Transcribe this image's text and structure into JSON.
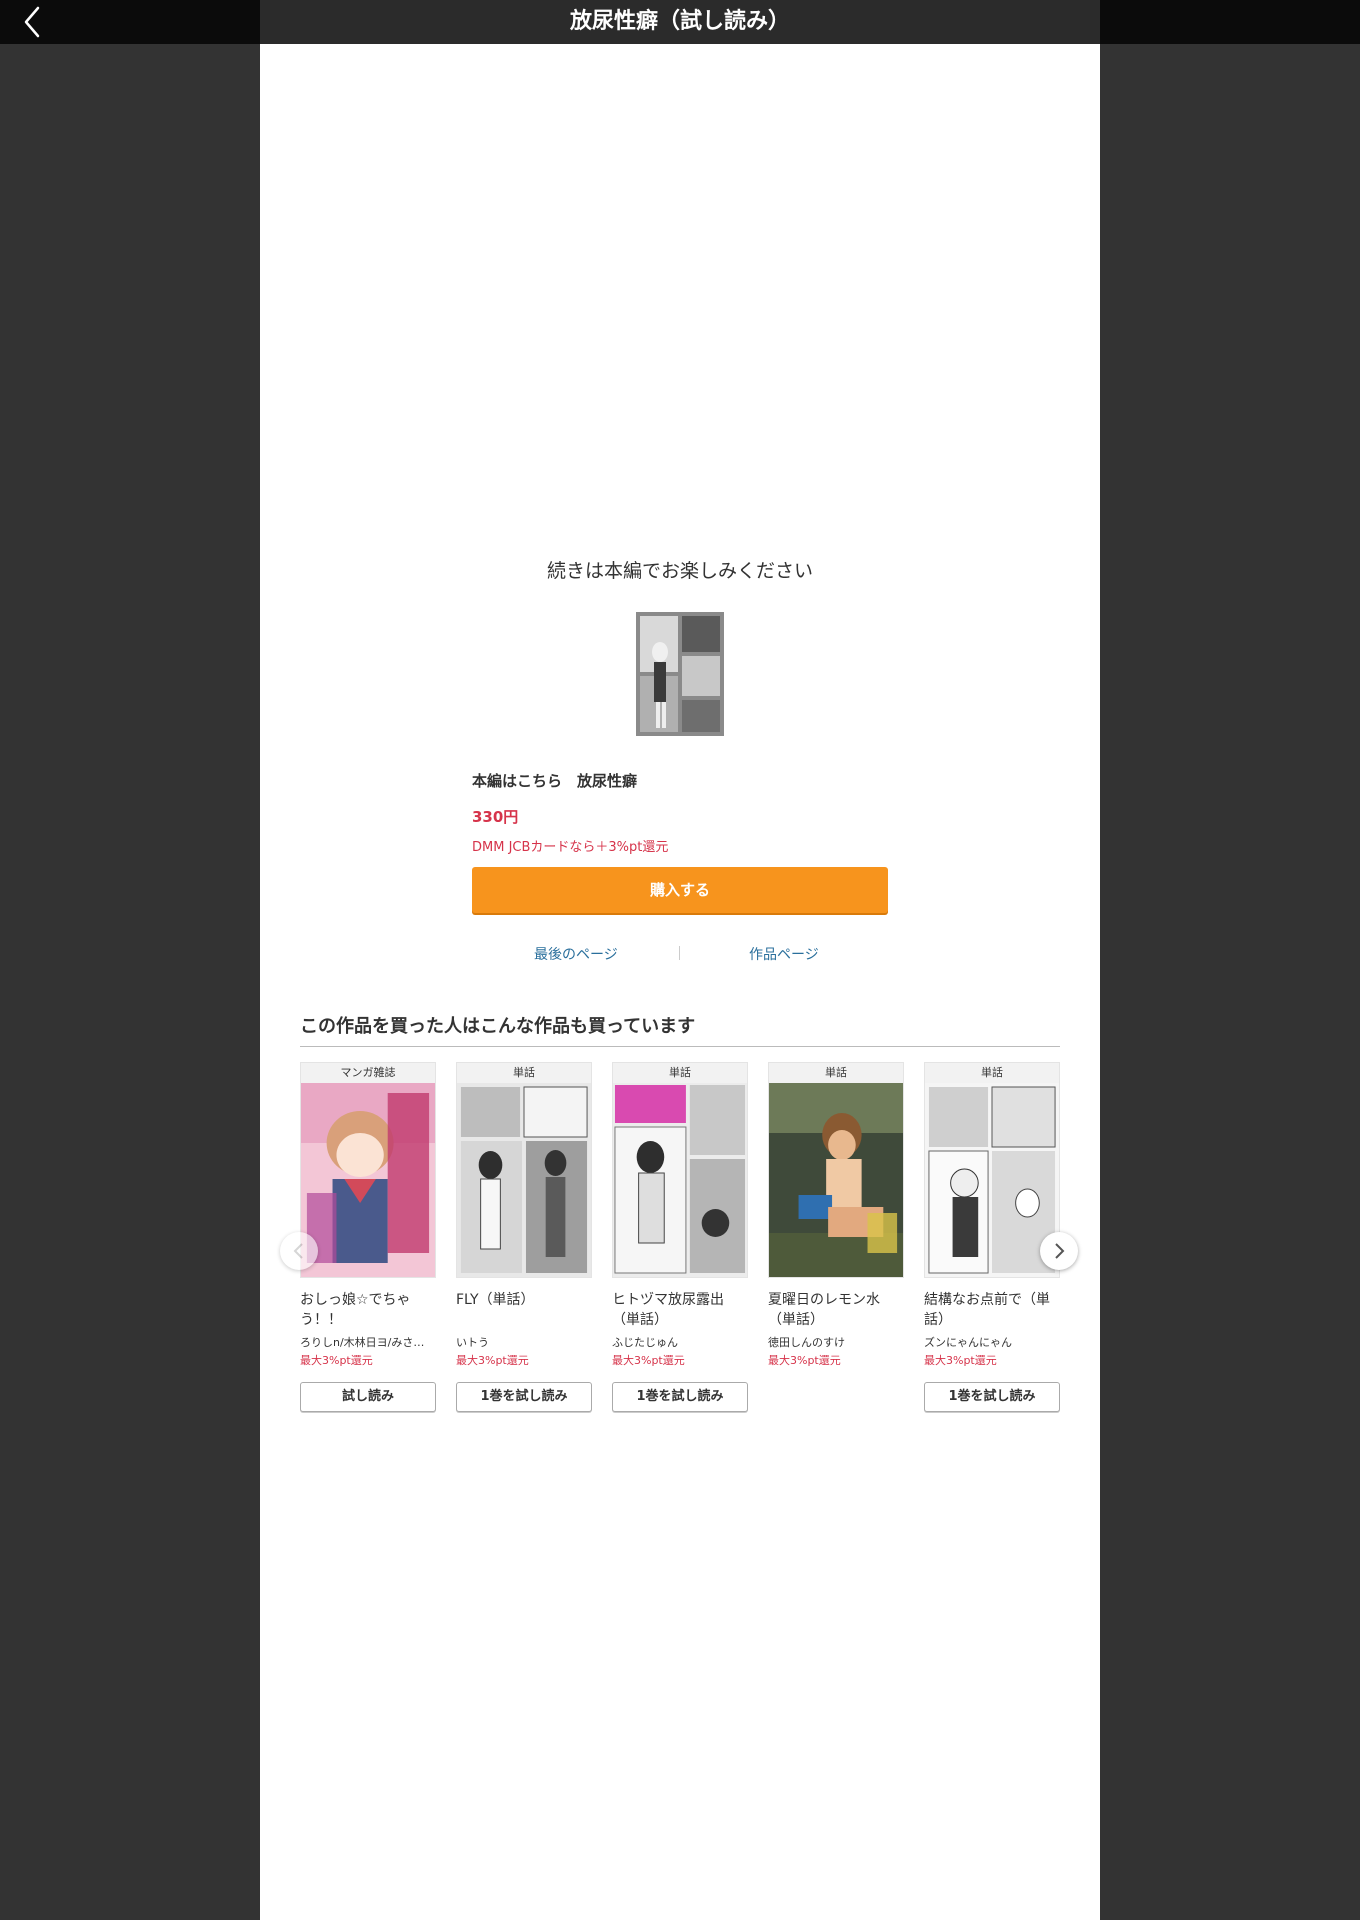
{
  "header": {
    "title": "放尿性癖（試し読み）",
    "back_icon": "chevron-left-icon"
  },
  "end_screen": {
    "message": "続きは本編でお楽しみください",
    "product_title": "本編はこちら　放尿性癖",
    "price": "330円",
    "point_note": "DMM JCBカードなら＋3%pt還元",
    "buy_label": "購入する",
    "last_page_label": "最後のページ",
    "work_page_label": "作品ページ"
  },
  "recommendations": {
    "heading": "この作品を買った人はこんな作品も買っています",
    "prev_icon": "chevron-left-icon",
    "next_icon": "chevron-right-icon",
    "items": [
      {
        "badge": "マンガ雑誌",
        "title": "おしっ娘☆でちゃう！！",
        "author": "ろりしn/木林日ヨ/みさ…",
        "points": "最大3%pt還元",
        "button": "試し読み"
      },
      {
        "badge": "単話",
        "title": "FLY（単話）",
        "author": "いトう",
        "points": "最大3%pt還元",
        "button": "1巻を試し読み"
      },
      {
        "badge": "単話",
        "title": "ヒトヅマ放尿露出（単話）",
        "author": "ふじたじゅん",
        "points": "最大3%pt還元",
        "button": "1巻を試し読み"
      },
      {
        "badge": "単話",
        "title": "夏曜日のレモン水（単話）",
        "author": "徳田しんのすけ",
        "points": "最大3%pt還元",
        "button": ""
      },
      {
        "badge": "単話",
        "title": "結構なお点前で（単話）",
        "author": "ズンにゃんにゃん",
        "points": "最大3%pt還元",
        "button": "1巻を試し読み"
      }
    ]
  },
  "colors": {
    "accent": "#f7941d",
    "price": "#d6334a",
    "link": "#2a6f9c",
    "background": "#333333"
  }
}
